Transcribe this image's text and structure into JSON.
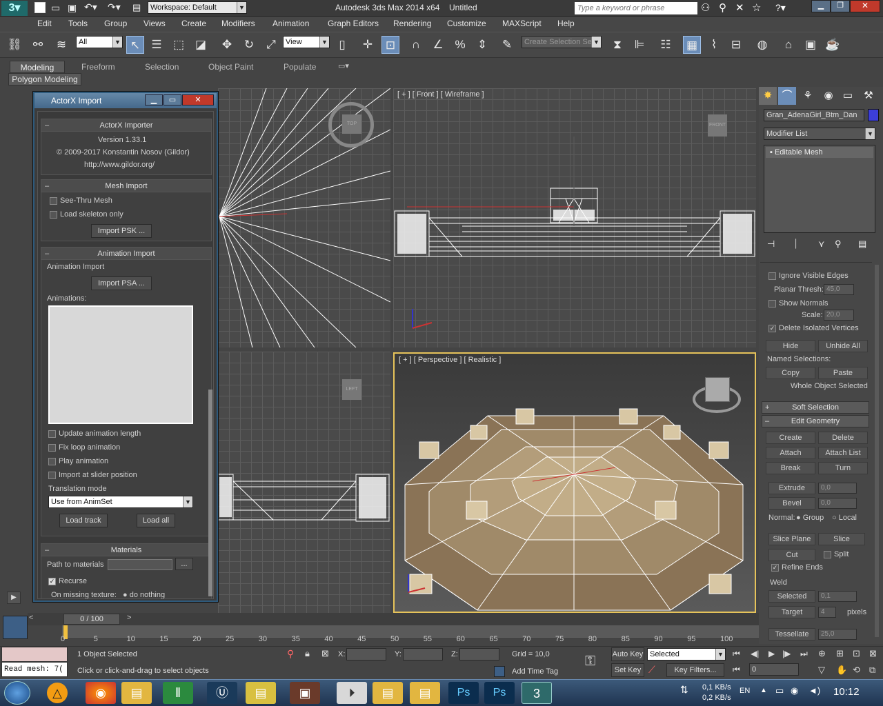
{
  "titlebar": {
    "workspace": "Workspace: Default",
    "app_title": "Autodesk 3ds Max  2014 x64",
    "doc_title": "Untitled",
    "search_placeholder": "Type a keyword or phrase"
  },
  "menu": [
    "Edit",
    "Tools",
    "Group",
    "Views",
    "Create",
    "Modifiers",
    "Animation",
    "Graph Editors",
    "Rendering",
    "Customize",
    "MAXScript",
    "Help"
  ],
  "toolbar": {
    "selection_filter": "All",
    "ref_coord": "View",
    "named_selection": "Create Selection Se"
  },
  "ribbon": {
    "tabs": [
      "Modeling",
      "Freeform",
      "Selection",
      "Object Paint",
      "Populate"
    ],
    "panel": "Polygon Modeling"
  },
  "viewports": {
    "front_label": "[ + ] [ Front ] [ Wireframe ]",
    "persp_label": "[ + ] [ Perspective ] [ Realistic ]",
    "top_cube": "TOP",
    "front_cube": "FRONT",
    "left_cube": "LEFT"
  },
  "actorx": {
    "title": "ActorX Import",
    "importer_head": "ActorX Importer",
    "version": "Version 1.33.1",
    "copyright": "© 2009-2017 Konstantin Nosov (Gildor)",
    "url": "http://www.gildor.org/",
    "mesh_head": "Mesh Import",
    "see_thru": "See-Thru Mesh",
    "load_skeleton": "Load skeleton only",
    "import_psk": "Import PSK ...",
    "anim_head": "Animation Import",
    "anim_group": "Animation Import",
    "import_psa": "Import PSA ...",
    "animations_label": "Animations:",
    "update_length": "Update animation length",
    "fix_loop": "Fix loop animation",
    "play_anim": "Play animation",
    "import_slider": "Import at slider position",
    "translation_label": "Translation mode",
    "translation_value": "Use from AnimSet",
    "load_track": "Load track",
    "load_all": "Load all",
    "materials_head": "Materials",
    "path_label": "Path to materials",
    "browse": "...",
    "recurse": "Recurse",
    "missing_label": "On missing texture:",
    "missing_value": "do nothing"
  },
  "cmdpanel": {
    "object_name": "Gran_AdenaGirl_Btm_Dan",
    "modifier_list": "Modifier List",
    "stack_item": "Editable Mesh",
    "ignore_edges": "Ignore Visible Edges",
    "planar_label": "Planar Thresh:",
    "planar_value": "45,0",
    "show_normals": "Show Normals",
    "scale_label": "Scale:",
    "scale_value": "20,0",
    "delete_isolated": "Delete Isolated Vertices",
    "hide": "Hide",
    "unhide_all": "Unhide All",
    "named_sel": "Named Selections:",
    "copy": "Copy",
    "paste": "Paste",
    "whole_object": "Whole Object Selected",
    "soft_selection": "Soft Selection",
    "edit_geometry": "Edit Geometry",
    "create": "Create",
    "delete": "Delete",
    "attach": "Attach",
    "attach_list": "Attach List",
    "break": "Break",
    "turn": "Turn",
    "extrude": "Extrude",
    "extrude_val": "0,0",
    "bevel": "Bevel",
    "bevel_val": "0,0",
    "normal_label": "Normal:",
    "group": "Group",
    "local": "Local",
    "slice_plane": "Slice Plane",
    "slice": "Slice",
    "cut": "Cut",
    "split": "Split",
    "refine_ends": "Refine Ends",
    "weld": "Weld",
    "selected": "Selected",
    "selected_val": "0,1",
    "target": "Target",
    "target_val": "4",
    "pixels": "pixels",
    "tessellate": "Tessellate",
    "tessellate_val": "25,0"
  },
  "timeline": {
    "frame": "0 / 100",
    "ticks": [
      "0",
      "5",
      "10",
      "15",
      "20",
      "25",
      "30",
      "35",
      "40",
      "45",
      "50",
      "55",
      "60",
      "65",
      "70",
      "75",
      "80",
      "85",
      "90",
      "95",
      "100"
    ]
  },
  "status": {
    "read_mesh": "Read mesh: 7(",
    "objects": "1 Object Selected",
    "prompt": "Click or click-and-drag to select objects",
    "x_label": "X:",
    "y_label": "Y:",
    "z_label": "Z:",
    "grid": "Grid = 10,0",
    "add_time_tag": "Add Time Tag",
    "auto_key": "Auto Key",
    "set_key": "Set Key",
    "selected": "Selected",
    "key_filters": "Key Filters...",
    "frame_val": "0"
  },
  "taskbar": {
    "net_up": "0,1 KB/s",
    "net_down": "0,2 KB/s",
    "lang": "EN",
    "time": "10:12"
  }
}
